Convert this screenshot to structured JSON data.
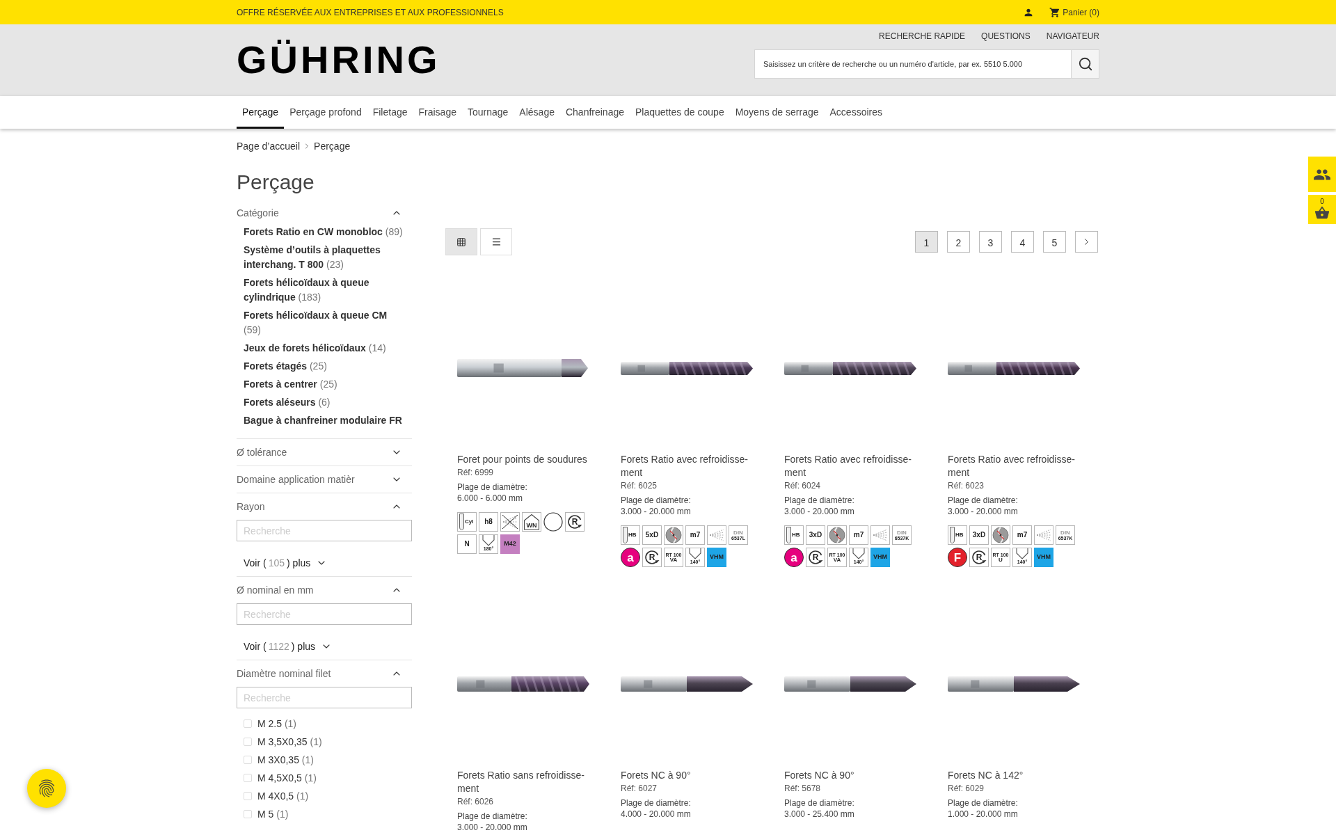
{
  "top_bar": {
    "notice": "OFFRE RÉSERVÉE AUX ENTREPRISES ET AUX PROFESSIONNELS",
    "cart": "Panier (0)"
  },
  "header": {
    "logo": "GÜHRING",
    "links": [
      "RECHERCHE RAPIDE",
      "QUESTIONS",
      "NAVIGATEUR"
    ],
    "search": {
      "placeholder": "Saisissez un critère de recherche ou un numéro d'article, par ex. 5510 5.000"
    }
  },
  "nav": [
    {
      "label": "Perçage",
      "selected": true
    },
    {
      "label": "Perçage profond",
      "selected": false
    },
    {
      "label": "Filetage",
      "selected": false
    },
    {
      "label": "Fraisage",
      "selected": false
    },
    {
      "label": "Tournage",
      "selected": false
    },
    {
      "label": "Alésage",
      "selected": false
    },
    {
      "label": "Chanfreinage",
      "selected": false
    },
    {
      "label": "Plaquettes de coupe",
      "selected": false
    },
    {
      "label": "Moyens de serrage",
      "selected": false
    },
    {
      "label": "Accessoires",
      "selected": false
    }
  ],
  "breadcrumb": [
    "Page d’accueil",
    "Perçage"
  ],
  "title": "Perçage",
  "filters": {
    "category": {
      "label": "Catégorie",
      "expanded": true,
      "items": [
        {
          "name": "Forets Ratio en CW monobloc",
          "count": "(89)"
        },
        {
          "name": "Système d’outils à plaquettes interchang. T 800",
          "count": "(23)"
        },
        {
          "name": "Forets hélicoïdaux à queue cylindrique",
          "count": "(183)"
        },
        {
          "name": "Forets hélicoïdaux à queue CM",
          "count": "(59)"
        },
        {
          "name": "Jeux de forets hélicoïdaux",
          "count": "(14)"
        },
        {
          "name": "Forets étagés",
          "count": "(25)"
        },
        {
          "name": "Forets à centrer",
          "count": "(25)"
        },
        {
          "name": "Forets aléseurs",
          "count": "(6)"
        },
        {
          "name": "Bague à chanfreiner modulaire FR"
        }
      ]
    },
    "sections": [
      {
        "label": "Ø tolérance",
        "expanded": false
      },
      {
        "label": "Domaine application matièr",
        "expanded": false
      },
      {
        "label": "Rayon",
        "expanded": true,
        "search": {
          "placeholder": "Recherche"
        },
        "more": {
          "prefix": "Voir (",
          "count": "105",
          "suffix": ") plus"
        }
      },
      {
        "label": "Ø nominal en mm",
        "expanded": true,
        "search": {
          "placeholder": "Recherche"
        },
        "more": {
          "prefix": "Voir (",
          "count": "1122",
          "suffix": ") plus"
        }
      },
      {
        "label": "Diamètre nominal filet",
        "expanded": true,
        "search": {
          "placeholder": "Recherche"
        },
        "options": [
          {
            "label": "M 2.5",
            "count": "(1)",
            "checked": false
          },
          {
            "label": "M 3,5X0,35",
            "count": "(1)",
            "checked": false
          },
          {
            "label": "M 3X0,35",
            "count": "(1)",
            "checked": false
          },
          {
            "label": "M 4,5X0,5",
            "count": "(1)",
            "checked": false
          },
          {
            "label": "M 4X0,5",
            "count": "(1)",
            "checked": false
          },
          {
            "label": "M 5",
            "count": "(1)",
            "checked": false
          }
        ]
      }
    ]
  },
  "view_toggle": [
    {
      "kind": "grid",
      "selected": true
    },
    {
      "kind": "list",
      "selected": false
    }
  ],
  "pagination": [
    {
      "label": "1",
      "selected": true
    },
    {
      "label": "2",
      "selected": false
    },
    {
      "label": "3",
      "selected": false
    },
    {
      "label": "4",
      "selected": false
    },
    {
      "label": "5",
      "selected": false
    }
  ],
  "products": [
    {
      "title": "Foret pour points de soudures",
      "ref": "Réf: 6999",
      "range_label": "Plage de diamètre:",
      "range": "6.000 - 6.000 mm",
      "badges": [
        {
          "kind": "shank",
          "text": "Cyl"
        },
        {
          "kind": "label",
          "text": "h8"
        },
        {
          "kind": "no-coolant"
        },
        {
          "kind": "house",
          "text": "WN"
        },
        {
          "kind": "ring"
        },
        {
          "kind": "rotation",
          "text": "R"
        },
        {
          "kind": "label",
          "text": "N"
        },
        {
          "kind": "angle",
          "text": "180°"
        },
        {
          "kind": "material",
          "text": "M42",
          "color": "#c47fc0"
        }
      ]
    },
    {
      "title": "Forets Ratio avec refroidisse-ment",
      "ref": "Réf: 6025",
      "range_label": "Plage de diamètre:",
      "range": "3.000 - 20.000 mm",
      "badges": [
        {
          "kind": "shank",
          "text": "HB"
        },
        {
          "kind": "label",
          "text": "5xD"
        },
        {
          "kind": "section"
        },
        {
          "kind": "label",
          "text": "m7"
        },
        {
          "kind": "coolant"
        },
        {
          "kind": "din",
          "text": "DIN",
          "sub": "6537L"
        },
        {
          "kind": "letter",
          "text": "a",
          "color": "#e6007e"
        },
        {
          "kind": "rotation",
          "text": "R"
        },
        {
          "kind": "stack",
          "text": "RT 100",
          "sub": "VA"
        },
        {
          "kind": "angle",
          "text": "140°"
        },
        {
          "kind": "material",
          "text": "VHM",
          "color": "#1ea5e6"
        }
      ]
    },
    {
      "title": "Forets Ratio avec refroidisse-ment",
      "ref": "Réf: 6024",
      "range_label": "Plage de diamètre:",
      "range": "3.000 - 20.000 mm",
      "badges": [
        {
          "kind": "shank",
          "text": "HB"
        },
        {
          "kind": "label",
          "text": "3xD"
        },
        {
          "kind": "section"
        },
        {
          "kind": "label",
          "text": "m7"
        },
        {
          "kind": "coolant"
        },
        {
          "kind": "din",
          "text": "DIN",
          "sub": "6537K"
        },
        {
          "kind": "letter",
          "text": "a",
          "color": "#e6007e"
        },
        {
          "kind": "rotation",
          "text": "R"
        },
        {
          "kind": "stack",
          "text": "RT 100",
          "sub": "VA"
        },
        {
          "kind": "angle",
          "text": "140°"
        },
        {
          "kind": "material",
          "text": "VHM",
          "color": "#1ea5e6"
        }
      ]
    },
    {
      "title": "Forets Ratio avec refroidisse-ment",
      "ref": "Réf: 6023",
      "range_label": "Plage de diamètre:",
      "range": "3.000 - 20.000 mm",
      "badges": [
        {
          "kind": "shank",
          "text": "HB"
        },
        {
          "kind": "label",
          "text": "3xD"
        },
        {
          "kind": "section"
        },
        {
          "kind": "label",
          "text": "m7"
        },
        {
          "kind": "coolant"
        },
        {
          "kind": "din",
          "text": "DIN",
          "sub": "6537K"
        },
        {
          "kind": "letter",
          "text": "F",
          "color": "#e3212b"
        },
        {
          "kind": "rotation",
          "text": "R"
        },
        {
          "kind": "stack",
          "text": "RT 100",
          "sub": "U"
        },
        {
          "kind": "angle",
          "text": "140°"
        },
        {
          "kind": "material",
          "text": "VHM",
          "color": "#1ea5e6"
        }
      ]
    },
    {
      "title": "Forets Ratio sans refroidisse-ment",
      "ref": "Réf: 6026",
      "range_label": "Plage de diamètre:",
      "range": "3.000 - 20.000 mm"
    },
    {
      "title": "Forets NC à 90°",
      "ref": "Réf: 6027",
      "range_label": "Plage de diamètre:",
      "range": "4.000 - 20.000 mm"
    },
    {
      "title": "Forets NC à 90°",
      "ref": "Réf: 5678",
      "range_label": "Plage de diamètre:",
      "range": "3.000 - 25.400 mm"
    },
    {
      "title": "Forets NC à 142°",
      "ref": "Réf: 6029",
      "range_label": "Plage de diamètre:",
      "range": "1.000 - 20.000 mm"
    }
  ],
  "side_widgets": {
    "basket_count": "0"
  }
}
